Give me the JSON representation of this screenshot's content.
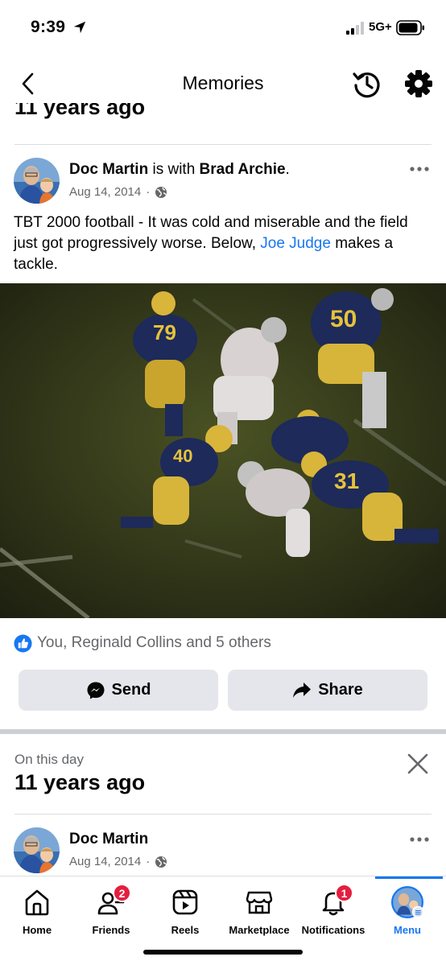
{
  "status_bar": {
    "time": "9:39",
    "network": "5G+",
    "icons": [
      "location-arrow-icon",
      "signal-icon",
      "battery-icon"
    ]
  },
  "header": {
    "title": "Memories",
    "icons": [
      "back-chevron-icon",
      "history-icon",
      "gear-icon"
    ]
  },
  "partial_section": {
    "heading": "11 years ago"
  },
  "post": {
    "author": "Doc Martin",
    "with_text": " is with ",
    "tagged": "Brad Archie",
    "tagged_suffix": ".",
    "date": "Aug 14, 2014",
    "date_separator": "·",
    "privacy_icon": "globe-icon",
    "text_before_link": "TBT 2000 football - It was cold and miserable and the field just got progressively worse.   Below, ",
    "link_text": "Joe Judge",
    "text_after_link": " makes a tackle.",
    "reactions_text": "You, Reginald Collins and 5 others",
    "send_label": "Send",
    "share_label": "Share"
  },
  "on_this_day": {
    "label": "On this day",
    "heading": "11 years ago"
  },
  "post2": {
    "author": "Doc Martin",
    "date": "Aug 14, 2014",
    "date_separator": "·"
  },
  "tabs": [
    {
      "label": "Home",
      "icon": "home-icon"
    },
    {
      "label": "Friends",
      "icon": "friends-icon",
      "badge": "2"
    },
    {
      "label": "Reels",
      "icon": "reels-icon"
    },
    {
      "label": "Marketplace",
      "icon": "marketplace-icon"
    },
    {
      "label": "Notifications",
      "icon": "bell-icon",
      "badge": "1"
    },
    {
      "label": "Menu",
      "icon": "profile-avatar-icon",
      "active": true
    }
  ],
  "colors": {
    "accent": "#1877f2",
    "badge": "#e41e3f",
    "button_bg": "#e4e6eb",
    "secondary_text": "#65676b",
    "photo_jersey_blue": "#1d2a5a",
    "photo_jersey_gold": "#e6c23a"
  }
}
